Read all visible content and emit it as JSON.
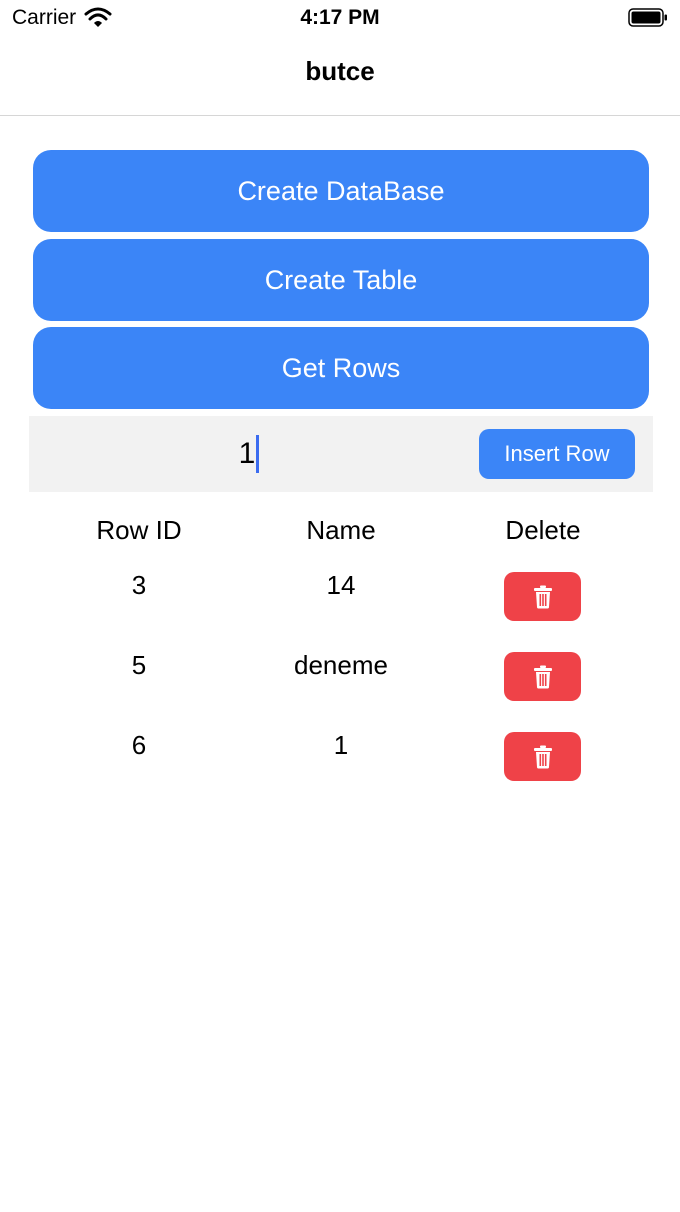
{
  "status_bar": {
    "carrier": "Carrier",
    "time": "4:17 PM"
  },
  "nav": {
    "title": "butce"
  },
  "actions": {
    "create_database": "Create DataBase",
    "create_table": "Create Table",
    "get_rows": "Get Rows"
  },
  "insert": {
    "input_value": "1",
    "button_label": "Insert Row"
  },
  "table": {
    "headers": [
      "Row ID",
      "Name",
      "Delete"
    ],
    "rows": [
      {
        "id": "3",
        "name": "14"
      },
      {
        "id": "5",
        "name": "deneme"
      },
      {
        "id": "6",
        "name": "1"
      }
    ]
  },
  "colors": {
    "primary": "#3b85f7",
    "danger": "#ef4248",
    "insert_bar_bg": "#f2f2f2"
  },
  "icons": {
    "wifi": "wifi-icon",
    "battery": "battery-icon",
    "delete": "trash-icon"
  }
}
